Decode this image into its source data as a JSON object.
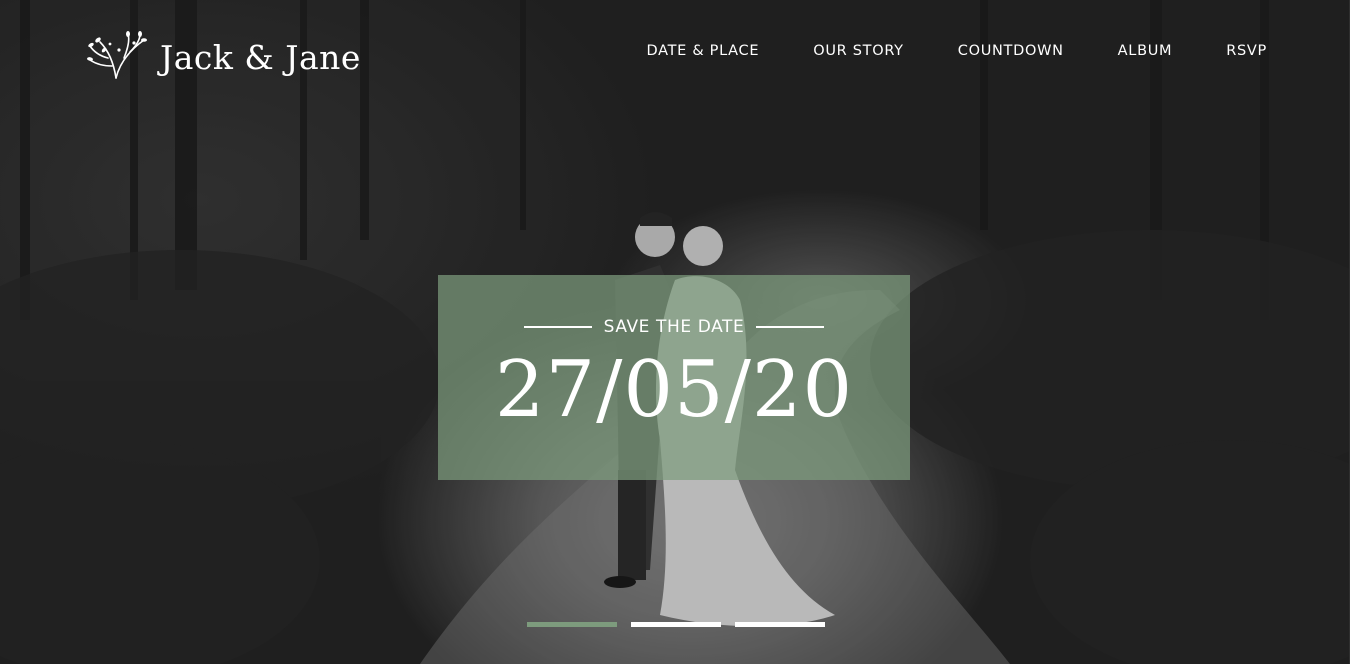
{
  "brand": {
    "name": "Jack & Jane",
    "icon": "leaf-branch-icon"
  },
  "nav": {
    "items": [
      {
        "label": "DATE & PLACE"
      },
      {
        "label": "OUR STORY"
      },
      {
        "label": "COUNTDOWN"
      },
      {
        "label": "ALBUM"
      },
      {
        "label": "RSVP"
      }
    ]
  },
  "hero": {
    "subtitle": "SAVE THE DATE",
    "date": "27/05/20",
    "slider": {
      "count": 3,
      "active_index": 0
    }
  },
  "colors": {
    "accent": "#7d9b7d",
    "overlay": "#7d9b7d",
    "text": "#ffffff"
  }
}
